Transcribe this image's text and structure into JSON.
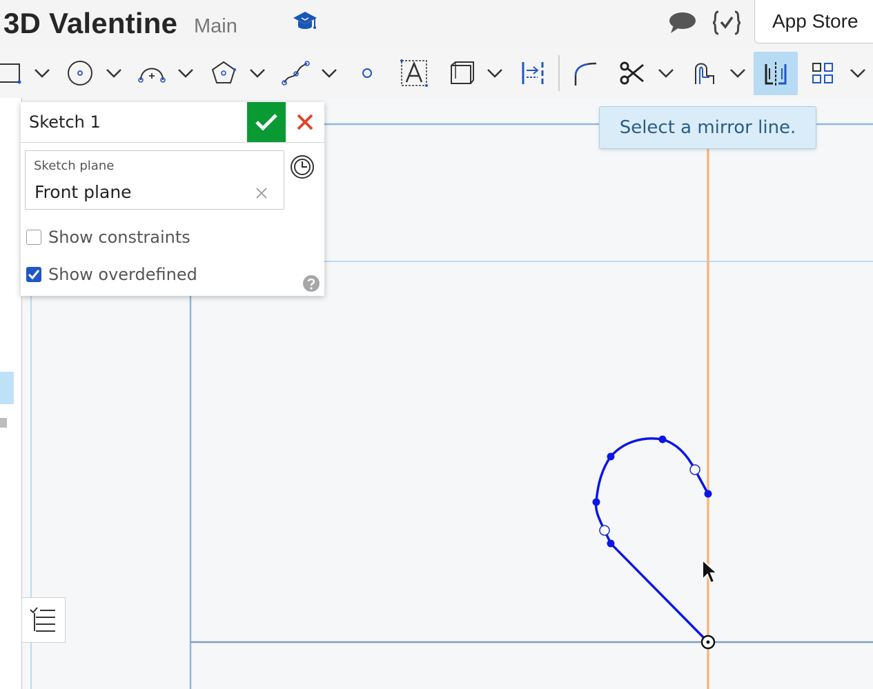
{
  "header": {
    "document_title": "3D Valentine",
    "branch": "Main",
    "app_store_label": "App Store",
    "icons": [
      "learning-center-icon",
      "comment-icon",
      "featurescript-icon"
    ]
  },
  "toolbar": {
    "tools": [
      {
        "name": "rectangle-tool",
        "dropdown": true
      },
      {
        "name": "circle-tool",
        "dropdown": true
      },
      {
        "name": "arc-tool",
        "dropdown": true
      },
      {
        "name": "polygon-tool",
        "dropdown": true
      },
      {
        "name": "spline-tool",
        "dropdown": true
      },
      {
        "name": "point-tool",
        "dropdown": false
      },
      {
        "name": "text-tool",
        "dropdown": false
      },
      {
        "name": "construction-tool",
        "dropdown": true
      },
      {
        "name": "use-tool",
        "dropdown": false
      },
      {
        "name": "fillet-tool",
        "dropdown": false
      },
      {
        "name": "trim-tool",
        "dropdown": true
      },
      {
        "name": "offset-tool",
        "dropdown": true
      },
      {
        "name": "mirror-tool",
        "dropdown": false,
        "active": true
      },
      {
        "name": "pattern-tool",
        "dropdown": true
      }
    ],
    "active_color": "#b7dbf3"
  },
  "sketch_dialog": {
    "title": "Sketch 1",
    "sketch_plane_label": "Sketch plane",
    "sketch_plane_value": "Front plane",
    "show_constraints_label": "Show constraints",
    "show_constraints_checked": false,
    "show_overdefined_label": "Show overdefined",
    "show_overdefined_checked": true,
    "ok_color": "#0a9a33",
    "cancel_color": "#e0452c"
  },
  "tooltip": {
    "text": "Select a mirror line."
  },
  "canvas": {
    "sketch_color": "#0b16e6",
    "mirror_line_color": "#f4b77f",
    "plane_outline_color": "#8fb8de"
  }
}
